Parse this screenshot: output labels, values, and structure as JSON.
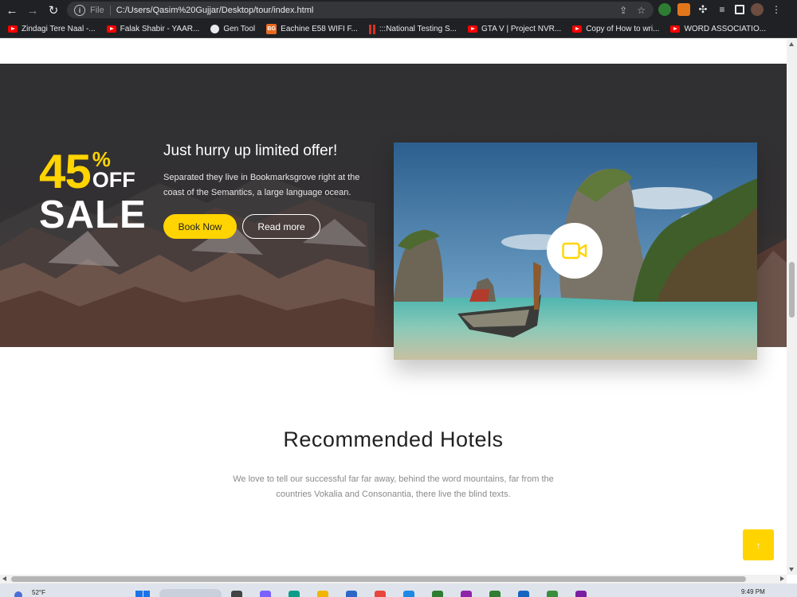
{
  "browser": {
    "scheme_label": "File",
    "url": "C:/Users/Qasim%20Gujjar/Desktop/tour/index.html",
    "bookmarks": [
      {
        "label": "Zindagi Tere Naal -...",
        "icon": "youtube-icon"
      },
      {
        "label": "Falak Shabir - YAAR...",
        "icon": "youtube-icon"
      },
      {
        "label": "Gen Tool",
        "icon": "globe-icon"
      },
      {
        "label": "Eachine E58 WIFI F...",
        "icon": "bg-icon"
      },
      {
        "label": ":::National Testing S...",
        "icon": "bars-icon"
      },
      {
        "label": "GTA V | Project NVR...",
        "icon": "youtube-icon"
      },
      {
        "label": "Copy of How to wri...",
        "icon": "youtube-icon"
      },
      {
        "label": "WORD ASSOCIATIO...",
        "icon": "youtube-icon"
      }
    ],
    "bg_favicon_text": "BG"
  },
  "sale": {
    "percent": "45",
    "percent_symbol": "%",
    "off": "OFF",
    "sale": "SALE",
    "heading": "Just hurry up limited offer!",
    "description": "Separated they live in Bookmarksgrove right at the coast of the Semantics, a large language ocean.",
    "book_label": "Book Now",
    "read_label": "Read more"
  },
  "hotels": {
    "title": "Recommended Hotels",
    "description": "We love to tell our successful far far away, behind the word mountains, far from the countries Vokalia and Consonantia, there live the blind texts."
  },
  "back_to_top": "↑",
  "taskbar": {
    "temperature": "52°F",
    "time": "9:49 PM"
  },
  "colors": {
    "accent": "#ffd400",
    "chrome": "#202124"
  }
}
